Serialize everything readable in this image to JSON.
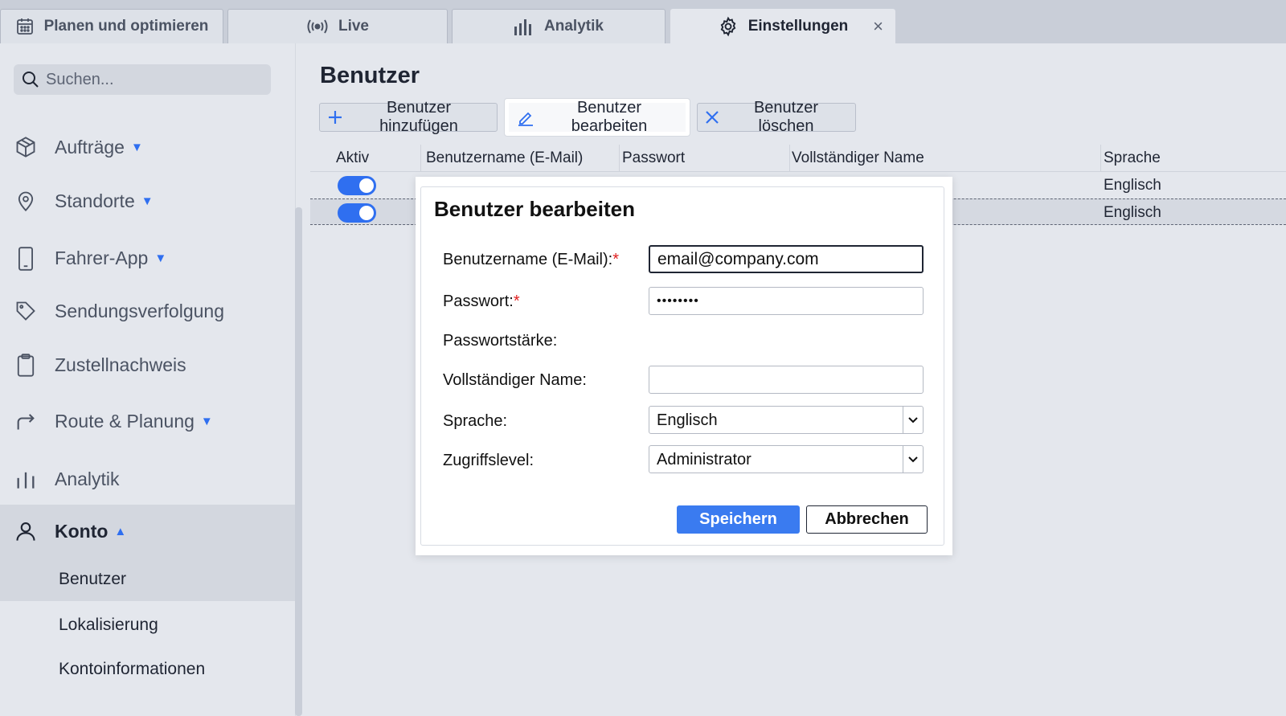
{
  "tabs": [
    {
      "label": "Planen und optimieren",
      "icon": "calendar-icon"
    },
    {
      "label": "Live",
      "icon": "broadcast-icon"
    },
    {
      "label": "Analytik",
      "icon": "bar-chart-icon"
    },
    {
      "label": "Einstellungen",
      "icon": "gear-icon",
      "active": true,
      "close": "×"
    }
  ],
  "sidebar": {
    "search_placeholder": "Suchen...",
    "items": [
      {
        "label": "Aufträge",
        "icon": "package-icon",
        "caret": "▼"
      },
      {
        "label": "Standorte",
        "icon": "location-pin-icon",
        "caret": "▼"
      },
      {
        "label": "Fahrer-App",
        "icon": "mobile-phone-icon",
        "caret": "▼"
      },
      {
        "label": "Sendungsverfolgung",
        "icon": "tag-icon"
      },
      {
        "label": "Zustellnachweis",
        "icon": "clipboard-icon"
      },
      {
        "label": "Route & Planung",
        "icon": "route-arrow-icon",
        "caret": "▼"
      },
      {
        "label": "Analytik",
        "icon": "bar-chart-icon"
      },
      {
        "label": "Konto",
        "icon": "user-icon",
        "caret": "▲",
        "expanded": true
      }
    ],
    "subitems": [
      {
        "label": "Benutzer",
        "selected": true
      },
      {
        "label": "Lokalisierung"
      },
      {
        "label": "Kontoinformationen"
      }
    ]
  },
  "main": {
    "title": "Benutzer",
    "toolbar": {
      "add_label": "Benutzer hinzufügen",
      "edit_label": "Benutzer bearbeiten",
      "delete_label": "Benutzer löschen"
    },
    "table": {
      "columns": [
        "Aktiv",
        "Benutzername (E-Mail)",
        "Passwort",
        "Vollständiger Name",
        "Sprache"
      ],
      "rows": [
        {
          "active": true,
          "language": "Englisch"
        },
        {
          "active": true,
          "language": "Englisch"
        }
      ]
    }
  },
  "dialog": {
    "title": "Benutzer bearbeiten",
    "username_label": "Benutzername (E-Mail):",
    "username_value": "email@company.com",
    "password_label": "Passwort:",
    "password_value": "••••••••",
    "strength_label": "Passwortstärke:",
    "fullname_label": "Vollständiger Name:",
    "fullname_value": "",
    "language_label": "Sprache:",
    "language_value": "Englisch",
    "access_label": "Zugriffslevel:",
    "access_value": "Administrator",
    "required_mark": "*",
    "save_label": "Speichern",
    "cancel_label": "Abbrechen"
  },
  "colors": {
    "accent": "#2f6ff0",
    "primary_button": "#3a7bf0",
    "required": "#e02020",
    "background": "#e4e7ed"
  }
}
